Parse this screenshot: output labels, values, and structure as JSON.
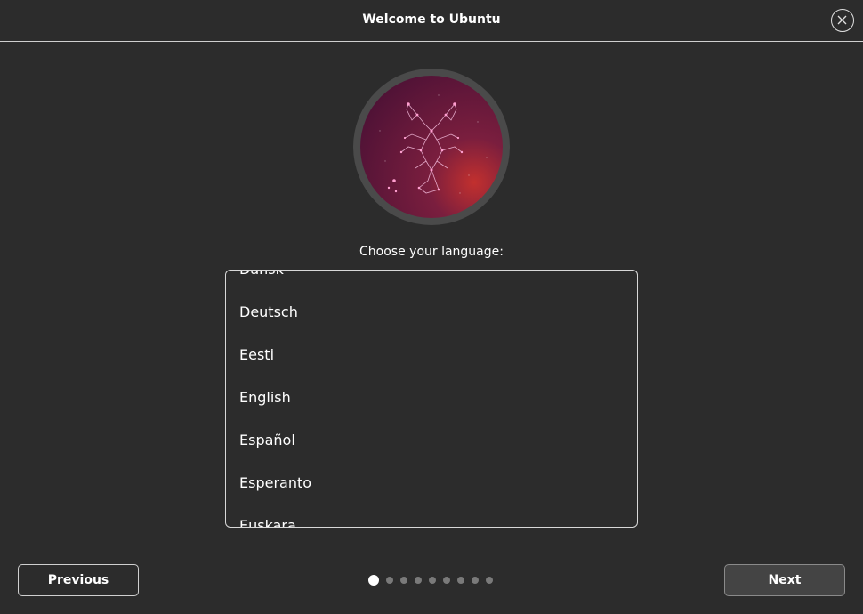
{
  "window": {
    "title": "Welcome to Ubuntu"
  },
  "main": {
    "prompt": "Choose your language:",
    "languages": [
      "Dansk",
      "Deutsch",
      "Eesti",
      "English",
      "Español",
      "Esperanto",
      "Euskara"
    ]
  },
  "footer": {
    "previous_label": "Previous",
    "next_label": "Next",
    "pages_total": 9,
    "current_page": 1
  },
  "colors": {
    "background": "#2c2c2c",
    "artwork_ring": "#4a4a4a",
    "artwork_fill": "#6b1a3f",
    "constellation": "#f08cc0"
  },
  "icons": {
    "close": "close-icon",
    "artwork": "numbat-constellation-icon"
  }
}
